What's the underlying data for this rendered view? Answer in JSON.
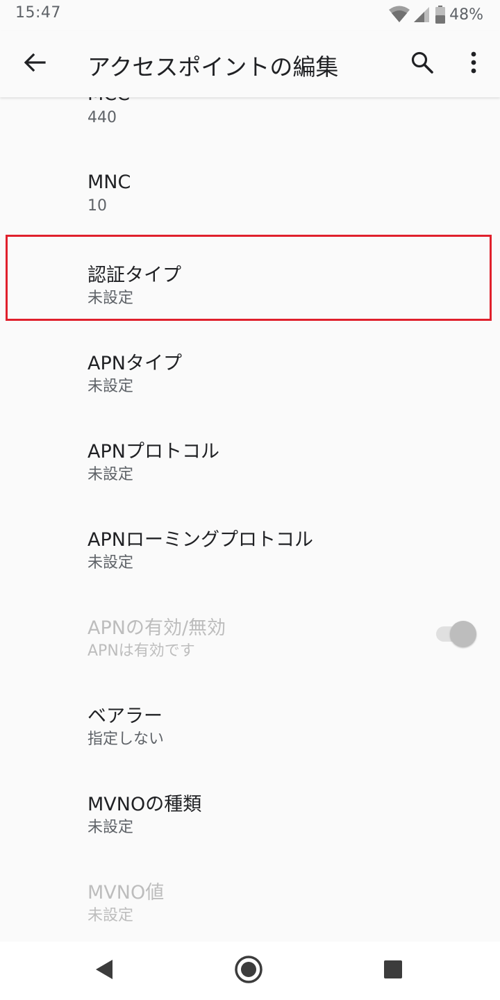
{
  "status_bar": {
    "time": "15:47",
    "battery_percent": "48%",
    "icons": [
      "wifi-icon",
      "cellular-signal-icon",
      "battery-icon"
    ]
  },
  "app_bar": {
    "title": "アクセスポイントの編集",
    "back_icon": "arrow-back-icon",
    "search_icon": "search-icon",
    "more_icon": "more-vert-icon"
  },
  "preferences": [
    {
      "title": "MCC",
      "summary": "440"
    },
    {
      "title": "MNC",
      "summary": "10"
    },
    {
      "title": "認証タイプ",
      "summary": "未設定",
      "highlighted": true
    },
    {
      "title": "APNタイプ",
      "summary": "未設定"
    },
    {
      "title": "APNプロトコル",
      "summary": "未設定"
    },
    {
      "title": "APNローミングプロトコル",
      "summary": "未設定"
    },
    {
      "title": "APNの有効/無効",
      "summary": "APNは有効です",
      "disabled": true,
      "toggle_on": true
    },
    {
      "title": "ベアラー",
      "summary": "指定しない"
    },
    {
      "title": "MVNOの種類",
      "summary": "未設定"
    },
    {
      "title": "MVNO値",
      "summary": "未設定",
      "disabled": true
    }
  ],
  "colors": {
    "background": "#fafafa",
    "highlight_border": "#e0202c",
    "disabled_text": "#bdbdbd"
  },
  "nav_bar": {
    "icons": [
      "nav-back-icon",
      "nav-home-icon",
      "nav-recents-icon"
    ]
  }
}
